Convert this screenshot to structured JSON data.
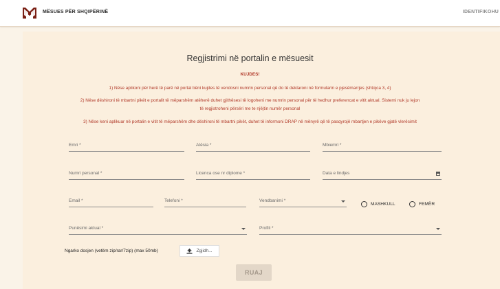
{
  "header": {
    "brand": "MËSUES PËR SHQIPËRINË",
    "login_label": "IDENTIFIKOHU",
    "logo_color": "#7a1f14"
  },
  "form": {
    "title": "Regjistrimi në portalin e mësuesit",
    "warning_heading": "KUJDES!",
    "notes": [
      "1) Nëse aplikoni për herë të parë në portal bëni kujdes të vendosni numrin personal që do të deklaroni në formularin e pjesëmarrjes (shtojca 3, 4)",
      "2) Nëse dëshironi të mbartni pikët e portalit të mëparshëm atëherë duhet gjithësesi të logoheni me numrin personal për të hedhur preferencat e vitit aktual. Sistemi nuk ju lejon",
      "të regjistroheni përsëri me te njëjtin numër personal",
      "3) Nëse keni aplikuar në portalin e vitit të mëparshëm dhe dëshironi të mbartni pikët, duhet të informoni DRAP në mënyrë që të pasqyrojë mbartjen e pikëve gjatë vlerësimit"
    ],
    "fields": {
      "emri": "Emri *",
      "atesia": "Atësia *",
      "mbiemri": "Mbiemri *",
      "numri_personal": "Numri personal *",
      "licenca": "Licenca ose nr diplome *",
      "datelindja": "Data e lindjes",
      "email": "Email *",
      "telefoni": "Telefoni *",
      "vendbanimi": "Vendbanimi *",
      "punesimi": "Punësimi aktual *",
      "profili": "Profili *"
    },
    "gender": {
      "male": "MASHKULL",
      "female": "FEMËR"
    },
    "upload": {
      "label": "Ngarko dosjen (vetëm zip/rar/7zip) (max 50mb)",
      "button": "Zgjidh..."
    },
    "save_label": "RUAJ",
    "accent_color": "#b13a2a"
  }
}
